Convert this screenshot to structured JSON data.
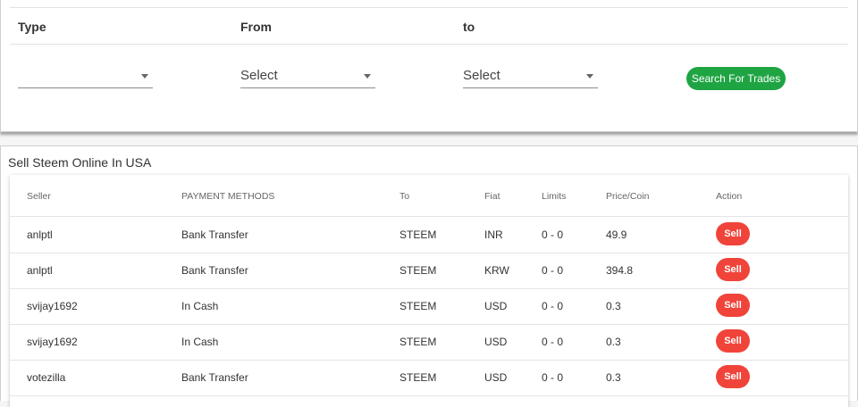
{
  "search": {
    "headers": {
      "type": "Type",
      "from": "From",
      "to": "to"
    },
    "type_value": "",
    "from_value": "Select",
    "to_value": "Select",
    "button_label": "Search For Trades"
  },
  "results": {
    "title": "Sell Steem Online In USA",
    "columns": {
      "seller": "Seller",
      "payment": "PAYMENT METHODS",
      "to": "To",
      "fiat": "Fiat",
      "limits": "Limits",
      "price": "Price/Coin",
      "action": "Action"
    },
    "rows": [
      {
        "seller": "anlptl",
        "payment": "Bank Transfer",
        "to": "STEEM",
        "fiat": "INR",
        "limits": "0 - 0",
        "price": "49.9",
        "action": "Sell"
      },
      {
        "seller": "anlptl",
        "payment": "Bank Transfer",
        "to": "STEEM",
        "fiat": "KRW",
        "limits": "0 - 0",
        "price": "394.8",
        "action": "Sell"
      },
      {
        "seller": "svijay1692",
        "payment": "In Cash",
        "to": "STEEM",
        "fiat": "USD",
        "limits": "0 - 0",
        "price": "0.3",
        "action": "Sell"
      },
      {
        "seller": "svijay1692",
        "payment": "In Cash",
        "to": "STEEM",
        "fiat": "USD",
        "limits": "0 - 0",
        "price": "0.3",
        "action": "Sell"
      },
      {
        "seller": "votezilla",
        "payment": "Bank Transfer",
        "to": "STEEM",
        "fiat": "USD",
        "limits": "0 - 0",
        "price": "0.3",
        "action": "Sell"
      }
    ]
  },
  "colors": {
    "search_button": "#1fa443",
    "sell_button": "#f0443a"
  }
}
